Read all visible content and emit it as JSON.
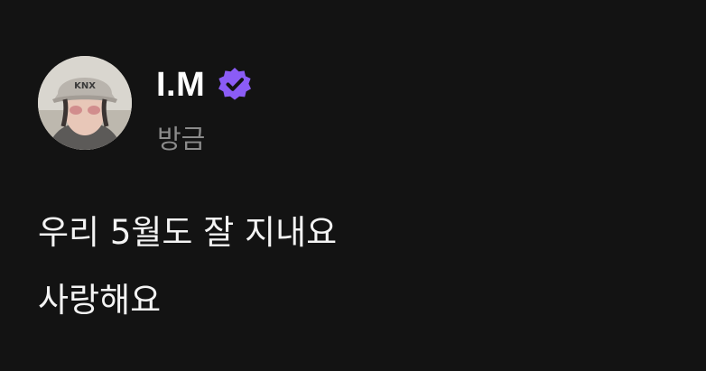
{
  "post": {
    "author": {
      "username": "I.M",
      "verified": true,
      "avatar": "profile-photo"
    },
    "timestamp": "방금",
    "text_lines": [
      "우리 5월도 잘 지내요",
      "사랑해요"
    ]
  },
  "colors": {
    "background": "#131313",
    "verified_badge": "#8b5cf6",
    "timestamp": "#8b8b8b",
    "text": "#f4f4f4"
  },
  "icons": {
    "verified": "verified-check-badge-icon"
  }
}
